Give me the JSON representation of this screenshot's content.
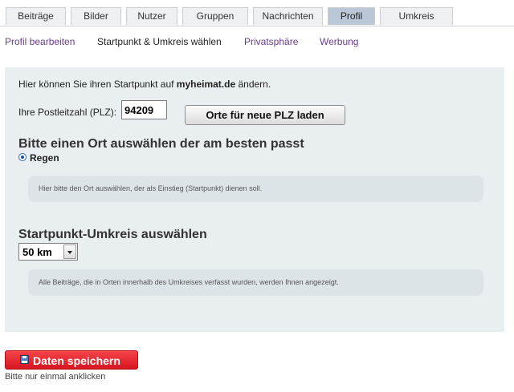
{
  "tabs": [
    {
      "label": "Beiträge",
      "active": false
    },
    {
      "label": "Bilder",
      "active": false
    },
    {
      "label": "Nutzer",
      "active": false
    },
    {
      "label": "Gruppen",
      "active": false
    },
    {
      "label": "Nachrichten",
      "active": false
    },
    {
      "label": "Profil",
      "active": true
    },
    {
      "label": "Umkreis",
      "active": false
    }
  ],
  "subnav": [
    {
      "label": "Profil bearbeiten",
      "current": false
    },
    {
      "label": "Startpunkt & Umkreis wählen",
      "current": true
    },
    {
      "label": "Privatsphäre",
      "current": false
    },
    {
      "label": "Werbung",
      "current": false
    }
  ],
  "intro": {
    "before": "Hier können Sie ihren Startpunkt auf ",
    "site": "myheimat.de",
    "after": " ändern."
  },
  "plz": {
    "label": "Ihre Postleitzahl (PLZ):",
    "value": "94209",
    "load_button": "Orte für neue PLZ laden"
  },
  "place": {
    "title": "Bitte einen Ort auswählen der am besten passt",
    "selected_option": "Regen",
    "hint": "Hier bitte den Ort auswählen, der als Einstieg (Startpunkt) dienen soll."
  },
  "radius": {
    "title": "Startpunkt-Umkreis auswählen",
    "selected": "50 km",
    "hint": "Alle Beiträge, die in Orten innerhalb des Umkreises verfasst wurden, werden Ihnen angezeigt."
  },
  "save": {
    "label": "Daten speichern",
    "icon": "floppy-disk-icon",
    "note": "Bitte nur einmal anklicken"
  },
  "colors": {
    "active_tab": "#b9c7d6",
    "link": "#6b3d8e",
    "panel": "#e9eef0",
    "save_button": "#e0252d"
  }
}
